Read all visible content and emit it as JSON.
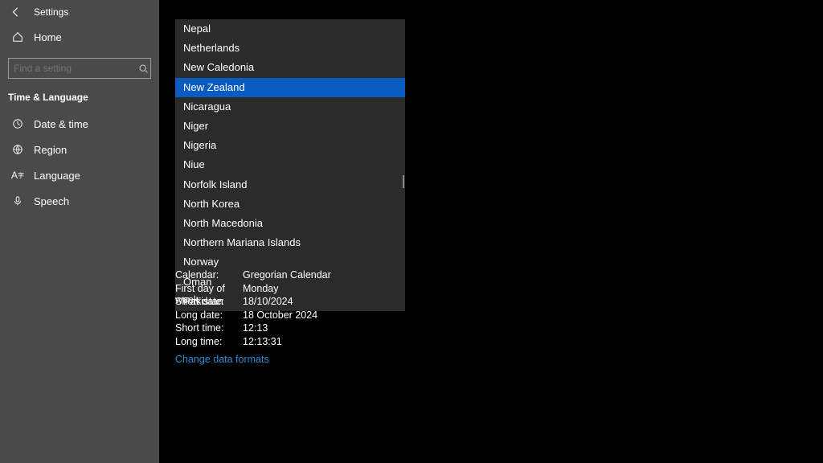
{
  "header": {
    "title": "Settings",
    "home": "Home"
  },
  "search": {
    "placeholder": "Find a setting"
  },
  "section": "Time & Language",
  "nav": [
    {
      "label": "Date & time"
    },
    {
      "label": "Region"
    },
    {
      "label": "Language"
    },
    {
      "label": "Speech"
    }
  ],
  "dropdown": {
    "items": [
      "Nepal",
      "Netherlands",
      "New Caledonia",
      "New Zealand",
      "Nicaragua",
      "Niger",
      "Nigeria",
      "Niue",
      "Norfolk Island",
      "North Korea",
      "North Macedonia",
      "Northern Mariana Islands",
      "Norway",
      "Oman",
      "Pakistan"
    ],
    "selected": "New Zealand"
  },
  "formats": [
    {
      "label": "Calendar:",
      "value": "Gregorian Calendar"
    },
    {
      "label": "First day of week:",
      "value": "Monday"
    },
    {
      "label": "Short date:",
      "value": "18/10/2024"
    },
    {
      "label": "Long date:",
      "value": "18 October 2024"
    },
    {
      "label": "Short time:",
      "value": "12:13"
    },
    {
      "label": "Long time:",
      "value": "12:13:31"
    }
  ],
  "link": "Change data formats"
}
